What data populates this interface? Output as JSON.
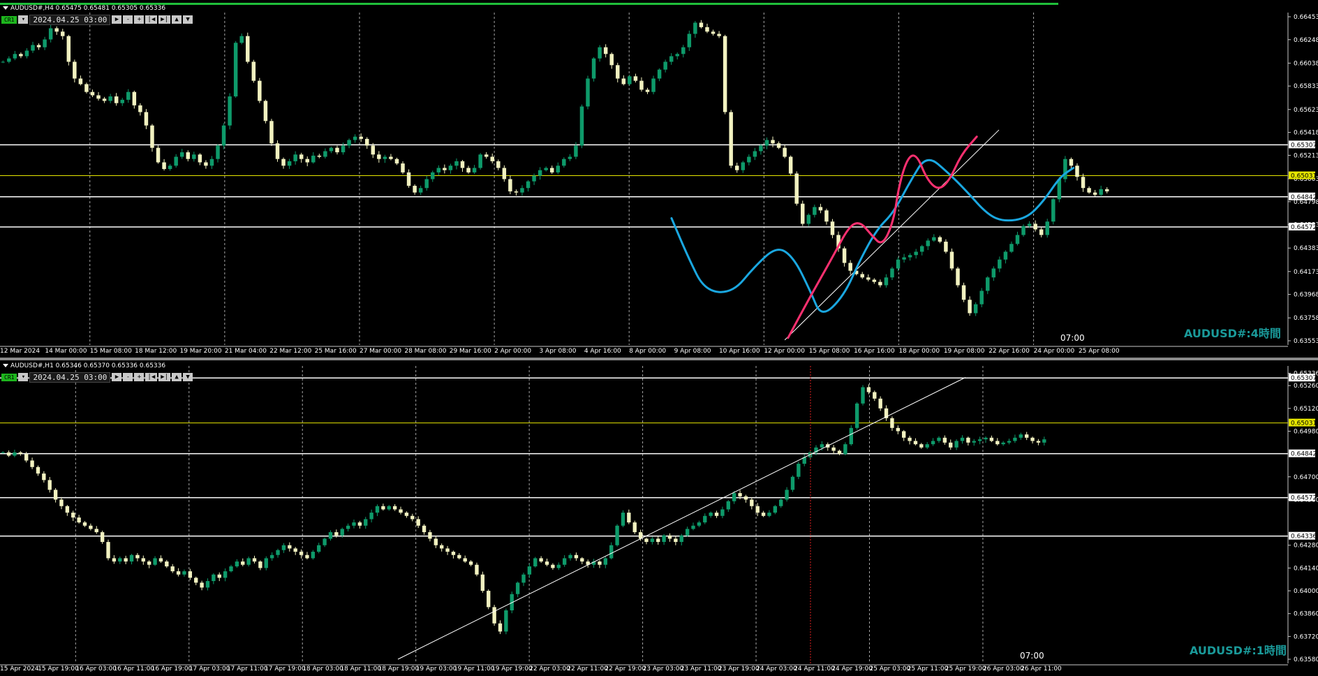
{
  "panel_top": {
    "header": "AUDUSD#,H4  0.65475 0.65481 0.65305 0.65336",
    "toolbar": {
      "badge": "CR1",
      "date": "2024.04.25 03:00"
    },
    "watermark": "AUDUSD#:4時間",
    "clock": "07:00"
  },
  "panel_bottom": {
    "header": "AUDUSD#,H1  0.65346 0.65370 0.65336 0.65336",
    "toolbar": {
      "badge": "CR1",
      "date": "2024.04.25 03:00"
    },
    "watermark": "AUDUSD#:1時間",
    "clock": "07:00"
  },
  "colors": {
    "bull": "#0e9a6a",
    "bear": "#f2f2c0",
    "level": "#ffffff",
    "yellow_level": "#e6e600",
    "blue_curve": "#1aa7e0",
    "pink_curve": "#ff3070",
    "marker": "#e02020",
    "accent_text": "#1a9a9a"
  },
  "chart_data": [
    {
      "type": "candlestick",
      "symbol": "AUDUSD#",
      "timeframe": "H4",
      "ylim": [
        0.63553,
        0.66453
      ],
      "y_ticks": [
        "0.66453",
        "0.66248",
        "0.66038",
        "0.65833",
        "0.65623",
        "0.65418",
        "0.65213",
        "0.65003",
        "0.64798",
        "0.64593",
        "0.64383",
        "0.64173",
        "0.63968",
        "0.63758",
        "0.63553"
      ],
      "x_ticks": [
        "12 Mar 2024",
        "14 Mar 00:00",
        "15 Mar 08:00",
        "18 Mar 12:00",
        "19 Mar 20:00",
        "21 Mar 04:00",
        "22 Mar 12:00",
        "25 Mar 16:00",
        "27 Mar 00:00",
        "28 Mar 08:00",
        "29 Mar 16:00",
        "2 Apr 00:00",
        "3 Apr 08:00",
        "4 Apr 16:00",
        "8 Apr 00:00",
        "9 Apr 08:00",
        "10 Apr 16:00",
        "12 Apr 00:00",
        "15 Apr 08:00",
        "16 Apr 16:00",
        "18 Apr 00:00",
        "19 Apr 08:00",
        "22 Apr 16:00",
        "24 Apr 00:00",
        "25 Apr 08:00"
      ],
      "levels": [
        {
          "value": 0.65307,
          "label": "0.65307",
          "kind": "white"
        },
        {
          "value": 0.65031,
          "label": "0.65031",
          "kind": "yellow"
        },
        {
          "value": 0.64842,
          "label": "0.64842",
          "kind": "white"
        },
        {
          "value": 0.64572,
          "label": "0.64572",
          "kind": "white"
        }
      ],
      "closes": [
        0.6605,
        0.6608,
        0.6612,
        0.661,
        0.6615,
        0.662,
        0.6618,
        0.6625,
        0.6635,
        0.6632,
        0.6628,
        0.6605,
        0.659,
        0.6585,
        0.6578,
        0.6575,
        0.6572,
        0.657,
        0.6574,
        0.6568,
        0.6571,
        0.6578,
        0.6566,
        0.656,
        0.6548,
        0.6528,
        0.6515,
        0.6509,
        0.6512,
        0.652,
        0.6524,
        0.6518,
        0.6522,
        0.6515,
        0.6512,
        0.6518,
        0.653,
        0.6548,
        0.6574,
        0.6622,
        0.6628,
        0.6605,
        0.6588,
        0.657,
        0.6552,
        0.6532,
        0.6518,
        0.6512,
        0.6516,
        0.6522,
        0.6518,
        0.6515,
        0.6521,
        0.652,
        0.6525,
        0.6528,
        0.6524,
        0.653,
        0.6535,
        0.6538,
        0.6536,
        0.653,
        0.6522,
        0.6518,
        0.652,
        0.6518,
        0.6514,
        0.6506,
        0.6494,
        0.6488,
        0.6492,
        0.65,
        0.6506,
        0.651,
        0.6508,
        0.6512,
        0.6516,
        0.651,
        0.6506,
        0.651,
        0.6522,
        0.652,
        0.6516,
        0.651,
        0.65,
        0.6489,
        0.6488,
        0.6492,
        0.6498,
        0.6503,
        0.6508,
        0.651,
        0.6506,
        0.6512,
        0.6518,
        0.652,
        0.653,
        0.6565,
        0.659,
        0.6608,
        0.6618,
        0.6612,
        0.6602,
        0.659,
        0.6585,
        0.6592,
        0.6588,
        0.658,
        0.6578,
        0.659,
        0.6598,
        0.6605,
        0.661,
        0.6612,
        0.6618,
        0.663,
        0.664,
        0.6636,
        0.6632,
        0.663,
        0.6628,
        0.656,
        0.6512,
        0.6508,
        0.6515,
        0.652,
        0.6525,
        0.653,
        0.6535,
        0.6532,
        0.6528,
        0.652,
        0.6505,
        0.6478,
        0.646,
        0.6468,
        0.6475,
        0.6472,
        0.6462,
        0.645,
        0.6438,
        0.6425,
        0.6418,
        0.6415,
        0.6412,
        0.641,
        0.6408,
        0.6405,
        0.6412,
        0.642,
        0.6428,
        0.643,
        0.6432,
        0.6435,
        0.644,
        0.6445,
        0.6448,
        0.6444,
        0.6435,
        0.642,
        0.6405,
        0.6392,
        0.638,
        0.6388,
        0.64,
        0.6412,
        0.642,
        0.6428,
        0.6435,
        0.6442,
        0.645,
        0.6458,
        0.646,
        0.6455,
        0.645,
        0.6462,
        0.6482,
        0.65,
        0.6518,
        0.6512,
        0.6502,
        0.6492,
        0.6488,
        0.6486,
        0.6491,
        0.6489
      ],
      "overlays": [
        {
          "name": "",
          "color": "blue",
          "points": [
            [
              0.605,
              0.6465
            ],
            [
              0.62,
              0.643
            ],
            [
              0.635,
              0.64
            ],
            [
              0.66,
              0.6398
            ],
            [
              0.68,
              0.6422
            ],
            [
              0.7,
              0.644
            ],
            [
              0.715,
              0.643
            ],
            [
              0.73,
              0.64
            ],
            [
              0.74,
              0.6376
            ],
            [
              0.76,
              0.6395
            ],
            [
              0.775,
              0.6428
            ],
            [
              0.79,
              0.6455
            ],
            [
              0.805,
              0.647
            ],
            [
              0.82,
              0.6498
            ],
            [
              0.835,
              0.6522
            ],
            [
              0.855,
              0.6505
            ],
            [
              0.87,
              0.649
            ],
            [
              0.89,
              0.6468
            ],
            [
              0.905,
              0.6462
            ],
            [
              0.925,
              0.6465
            ],
            [
              0.94,
              0.648
            ],
            [
              0.955,
              0.6502
            ],
            [
              0.967,
              0.651
            ]
          ]
        },
        {
          "name": "",
          "color": "pink",
          "points": [
            [
              0.71,
              0.6358
            ],
            [
              0.73,
              0.6395
            ],
            [
              0.75,
              0.643
            ],
            [
              0.765,
              0.6458
            ],
            [
              0.775,
              0.6462
            ],
            [
              0.785,
              0.645
            ],
            [
              0.795,
              0.644
            ],
            [
              0.805,
              0.6462
            ],
            [
              0.81,
              0.6495
            ],
            [
              0.818,
              0.652
            ],
            [
              0.826,
              0.6522
            ],
            [
              0.835,
              0.65
            ],
            [
              0.845,
              0.649
            ],
            [
              0.855,
              0.6498
            ],
            [
              0.866,
              0.6522
            ],
            [
              0.88,
              0.6538
            ]
          ]
        }
      ],
      "trendline": {
        "from": [
          0.707,
          0.6356
        ],
        "to": [
          0.9,
          0.6544
        ]
      }
    },
    {
      "type": "candlestick",
      "symbol": "AUDUSD#",
      "timeframe": "H1",
      "ylim": [
        0.6358,
        0.65355
      ],
      "y_ticks": [
        "0.65336",
        "0.65260",
        "0.65120",
        "0.64980",
        "0.64700",
        "0.64560",
        "0.64280",
        "0.64140",
        "0.64000",
        "0.63860",
        "0.63720",
        "0.63580"
      ],
      "x_ticks": [
        "15 Apr 2024",
        "15 Apr 19:00",
        "16 Apr 03:00",
        "16 Apr 11:00",
        "16 Apr 19:00",
        "17 Apr 03:00",
        "17 Apr 11:00",
        "17 Apr 19:00",
        "18 Apr 03:00",
        "18 Apr 11:00",
        "18 Apr 19:00",
        "19 Apr 03:00",
        "19 Apr 11:00",
        "19 Apr 19:00",
        "22 Apr 03:00",
        "22 Apr 11:00",
        "22 Apr 19:00",
        "23 Apr 03:00",
        "23 Apr 11:00",
        "23 Apr 19:00",
        "24 Apr 03:00",
        "24 Apr 11:00",
        "24 Apr 19:00",
        "25 Apr 03:00",
        "25 Apr 11:00",
        "25 Apr 19:00",
        "26 Apr 03:00",
        "26 Apr 11:00"
      ],
      "levels": [
        {
          "value": 0.65307,
          "label": "0.65307",
          "kind": "white"
        },
        {
          "value": 0.65031,
          "label": "0.65031",
          "kind": "yellow"
        },
        {
          "value": 0.64842,
          "label": "0.64842",
          "kind": "white"
        },
        {
          "value": 0.64572,
          "label": "0.64572",
          "kind": "white"
        },
        {
          "value": 0.64336,
          "label": "0.64336",
          "kind": "white"
        }
      ],
      "closes": [
        0.6485,
        0.6483,
        0.6485,
        0.6484,
        0.648,
        0.6476,
        0.6472,
        0.6468,
        0.6462,
        0.6456,
        0.6452,
        0.6448,
        0.6445,
        0.6442,
        0.644,
        0.6438,
        0.6436,
        0.643,
        0.642,
        0.6418,
        0.642,
        0.6418,
        0.6422,
        0.642,
        0.6418,
        0.6416,
        0.642,
        0.6418,
        0.6415,
        0.6412,
        0.641,
        0.6412,
        0.6408,
        0.6405,
        0.6402,
        0.6406,
        0.641,
        0.6408,
        0.6412,
        0.6415,
        0.6418,
        0.6416,
        0.642,
        0.6418,
        0.6414,
        0.642,
        0.6422,
        0.6425,
        0.6428,
        0.6426,
        0.6424,
        0.6422,
        0.642,
        0.6424,
        0.6428,
        0.6432,
        0.6436,
        0.6434,
        0.6438,
        0.644,
        0.6442,
        0.644,
        0.6444,
        0.6448,
        0.6452,
        0.645,
        0.6452,
        0.645,
        0.6448,
        0.6446,
        0.6444,
        0.644,
        0.6436,
        0.6432,
        0.6428,
        0.6426,
        0.6424,
        0.6422,
        0.642,
        0.6418,
        0.6416,
        0.641,
        0.64,
        0.639,
        0.638,
        0.6375,
        0.6388,
        0.6398,
        0.6405,
        0.641,
        0.6415,
        0.642,
        0.6418,
        0.6416,
        0.6414,
        0.6416,
        0.642,
        0.6422,
        0.642,
        0.6418,
        0.6416,
        0.6418,
        0.6416,
        0.642,
        0.6428,
        0.644,
        0.6448,
        0.6442,
        0.6436,
        0.6432,
        0.643,
        0.6432,
        0.643,
        0.6434,
        0.6432,
        0.643,
        0.6434,
        0.6438,
        0.644,
        0.6442,
        0.6446,
        0.6448,
        0.6446,
        0.645,
        0.6455,
        0.646,
        0.6458,
        0.6456,
        0.6452,
        0.6448,
        0.6446,
        0.6448,
        0.6452,
        0.6456,
        0.6462,
        0.647,
        0.6478,
        0.6482,
        0.6485,
        0.6488,
        0.649,
        0.6488,
        0.6486,
        0.6484,
        0.649,
        0.65,
        0.6515,
        0.6525,
        0.6522,
        0.6518,
        0.6512,
        0.6506,
        0.65,
        0.6498,
        0.6494,
        0.6492,
        0.649,
        0.6488,
        0.649,
        0.6492,
        0.6494,
        0.6491,
        0.6488,
        0.6492,
        0.6494,
        0.6491,
        0.6492,
        0.6493,
        0.6494,
        0.6492,
        0.649,
        0.6491,
        0.6492,
        0.6494,
        0.6496,
        0.6494,
        0.6492,
        0.6491,
        0.6493
      ],
      "trendline": {
        "from": [
          0.38,
          0.6358
        ],
        "to": [
          0.922,
          0.6531
        ]
      },
      "marker": {
        "label": "07:00",
        "x_frac": 0.774
      }
    }
  ]
}
